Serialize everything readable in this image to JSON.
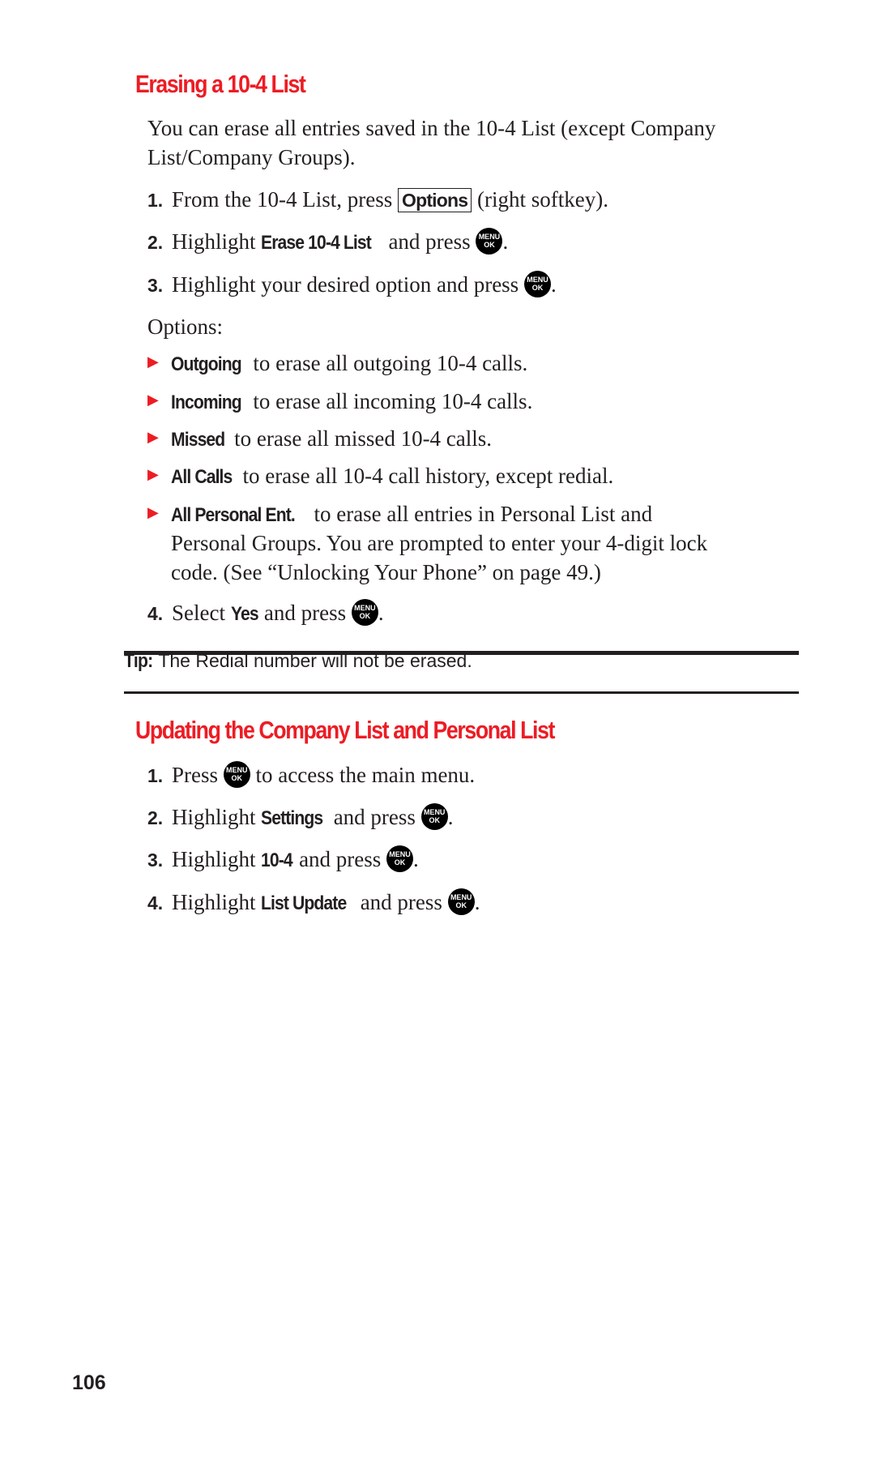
{
  "section1": {
    "heading": "Erasing a 10-4 List",
    "intro_line1": "You can erase all entries saved in the 10-4 List (except Company",
    "intro_line2": "List/Company Groups).",
    "steps": [
      {
        "num": "1.",
        "pre": "From the 10-4 List, press ",
        "softkey": "Options",
        "post": " (right softkey)."
      },
      {
        "num": "2.",
        "pre": "Highlight ",
        "bold": "Erase 10-4 List",
        "post": " and press ",
        "end": "."
      },
      {
        "num": "3.",
        "pre": "Highlight your desired option and press ",
        "end": "."
      },
      {
        "num": "4.",
        "pre": "Select ",
        "bold": "Yes",
        "post": " and press ",
        "end": "."
      }
    ],
    "options_label": "Options:",
    "options": [
      {
        "bold": "Outgoing",
        "text": " to erase all outgoing 10-4 calls."
      },
      {
        "bold": "Incoming",
        "text": " to erase all incoming 10-4 calls."
      },
      {
        "bold": "Missed",
        "text": " to erase all missed 10-4 calls."
      },
      {
        "bold": "All Calls",
        "text": " to erase all 10-4 call history, except redial."
      },
      {
        "bold": "All Personal Ent.",
        "text": " to erase all entries in Personal List and",
        "line2": "Personal Groups. You are prompted to enter your 4-digit lock",
        "line3": "code. (See “Unlocking Your Phone” on page 49.)"
      }
    ]
  },
  "tip": {
    "label": "Tip:",
    "text": " The Redial number will not be erased."
  },
  "section2": {
    "heading": "Updating the Company List and Personal List",
    "steps": [
      {
        "num": "1.",
        "pre": "Press ",
        "post": " to access the main menu."
      },
      {
        "num": "2.",
        "pre": "Highlight ",
        "bold": "Settings",
        "post": " and press ",
        "end": "."
      },
      {
        "num": "3.",
        "pre": "Highlight ",
        "bold": "10-4",
        "post": " and press ",
        "end": "."
      },
      {
        "num": "4.",
        "pre": "Highlight ",
        "bold": "List Update",
        "post": " and press ",
        "end": "."
      }
    ]
  },
  "menu_key": {
    "icon": "menu-ok-key-icon",
    "top": "MENU",
    "bottom": "OK"
  },
  "page_number": "106",
  "colors": {
    "accent": "#ed1c24",
    "text": "#231f20"
  }
}
